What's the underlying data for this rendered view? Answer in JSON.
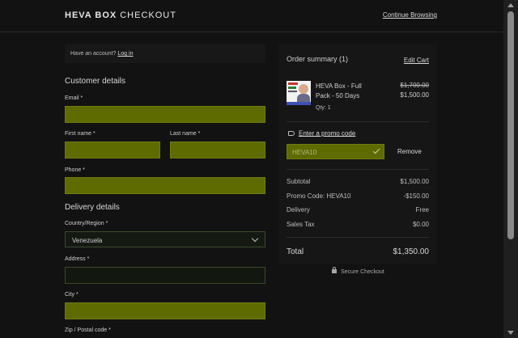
{
  "header": {
    "brand_bold": "HEVA BOX",
    "brand_thin": "CHECKOUT",
    "continue_label": "Continue Browsing"
  },
  "login": {
    "prompt": "Have an account?",
    "link": "Log in"
  },
  "customer": {
    "title": "Customer details",
    "email_label": "Email *",
    "first_name_label": "First name *",
    "last_name_label": "Last name *",
    "phone_label": "Phone *"
  },
  "delivery": {
    "title": "Delivery details",
    "country_label": "Country/Region *",
    "country_value": "Venezuela",
    "address_label": "Address *",
    "city_label": "City *",
    "zip_label": "Zip / Postal code *"
  },
  "summary": {
    "title": "Order summary (1)",
    "edit_cart": "Edit Cart",
    "product": {
      "name": "HEVA Box - Full Pack - 50 Days",
      "qty": "Qty: 1",
      "price_old": "$1,700.00",
      "price_new": "$1,500.00",
      "image_icon": "product-thumbnail"
    },
    "promo": {
      "link": "Enter a promo code",
      "code": "HEVA10",
      "remove": "Remove"
    },
    "rows": [
      {
        "label": "Subtotal",
        "value": "$1,500.00"
      },
      {
        "label": "Promo Code: HEVA10",
        "value": "-$150.00"
      },
      {
        "label": "Delivery",
        "value": "Free"
      },
      {
        "label": "Sales Tax",
        "value": "$0.00"
      }
    ],
    "total_label": "Total",
    "total_value": "$1,350.00"
  },
  "secure": "Secure Checkout",
  "colors": {
    "background": "#121212",
    "field_highlight": "#5e6b00",
    "panel": "#161616"
  }
}
